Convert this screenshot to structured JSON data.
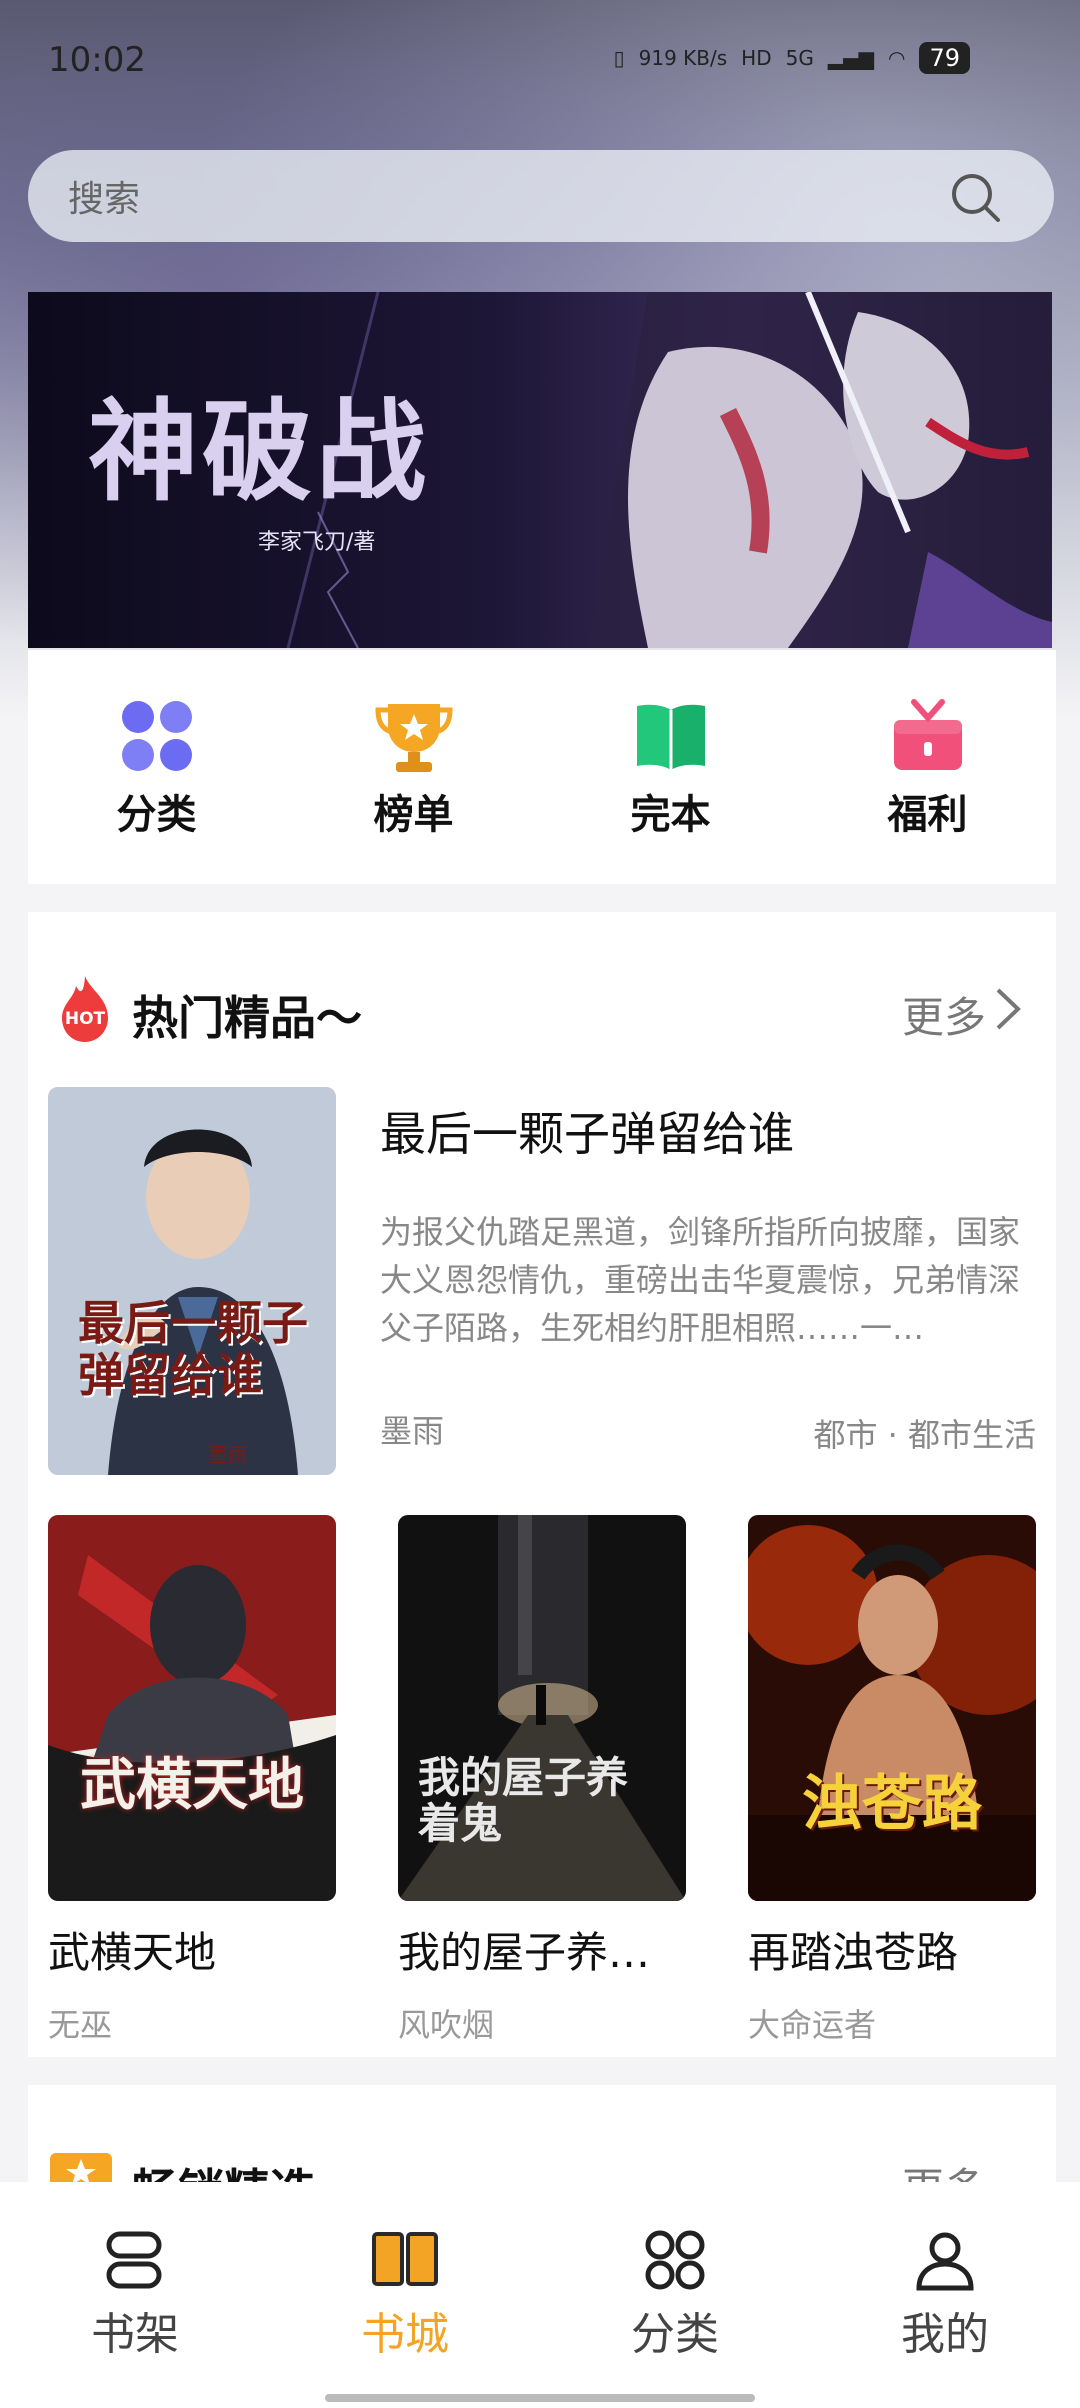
{
  "status_bar": {
    "time": "10:02",
    "speed": "919 KB/s",
    "network": "5G",
    "battery": "79"
  },
  "search": {
    "placeholder": "搜索"
  },
  "banner": {
    "title": "神破战",
    "author": "李家飞刀/著"
  },
  "quick_links": [
    {
      "label": "分类",
      "icon": "grid-icon",
      "color": "#6c6cf2"
    },
    {
      "label": "榜单",
      "icon": "trophy-icon",
      "color": "#f5a623"
    },
    {
      "label": "完本",
      "icon": "book-icon",
      "color": "#22c77a"
    },
    {
      "label": "福利",
      "icon": "gift-icon",
      "color": "#f0507a"
    }
  ],
  "hot_section": {
    "badge": "HOT",
    "title": "热门精品～",
    "more": "更多",
    "featured": {
      "title": "最后一颗子弹留给谁",
      "description": "为报父仇踏足黑道，剑锋所指所向披靡，国家大义恩怨情仇，重磅出击华夏震惊，兄弟情深父子陌路，生死相约肝胆相照……一…",
      "author": "墨雨",
      "tags": "都市 · 都市生活",
      "cover_title": "最后一颗子弹留给谁",
      "cover_author": "墨雨"
    },
    "books": [
      {
        "title": "武横天地",
        "author": "无巫",
        "cover_title": "武横天地"
      },
      {
        "title": "我的屋子养…",
        "author": "风吹烟",
        "cover_title": "我的屋子养着鬼"
      },
      {
        "title": "再踏浊苍路",
        "author": "大命运者",
        "cover_title": "浊苍路"
      }
    ]
  },
  "second_section": {
    "title": "畅销精选～",
    "more": "更多"
  },
  "tabbar": [
    {
      "label": "书架",
      "icon": "bookshelf-icon",
      "active": false
    },
    {
      "label": "书城",
      "icon": "open-book-icon",
      "active": true
    },
    {
      "label": "分类",
      "icon": "category-icon",
      "active": false
    },
    {
      "label": "我的",
      "icon": "profile-icon",
      "active": false
    }
  ],
  "colors": {
    "accent": "#f3a425",
    "hot_red": "#ee3b3b"
  }
}
